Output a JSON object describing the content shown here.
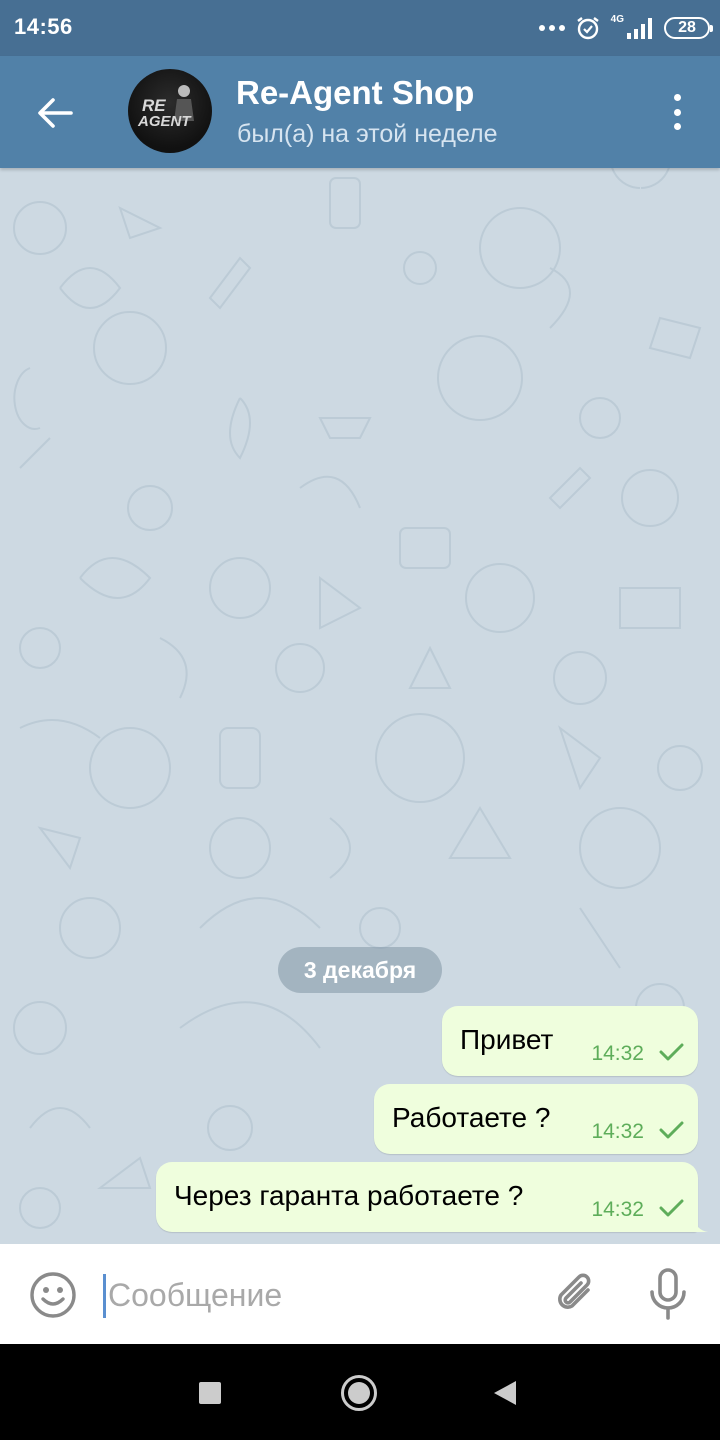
{
  "status_bar": {
    "time": "14:56",
    "network": "4G",
    "battery": "28"
  },
  "header": {
    "title": "Re-Agent Shop",
    "last_seen": "был(а) на этой неделе",
    "avatar_text_line1": "RE",
    "avatar_text_line2": "AGENT",
    "back_icon": "arrow-left-icon",
    "menu_icon": "more-vertical-icon"
  },
  "chat": {
    "date_separator": "3 декабря",
    "messages": [
      {
        "text": "Привет",
        "time": "14:32",
        "status": "sent"
      },
      {
        "text": "Работаете ?",
        "time": "14:32",
        "status": "sent"
      },
      {
        "text": "Через гаранта работаете ?",
        "time": "14:32",
        "status": "sent"
      }
    ]
  },
  "input": {
    "placeholder": "Сообщение",
    "value": "",
    "emoji_icon": "emoji-icon",
    "attach_icon": "paperclip-icon",
    "mic_icon": "microphone-icon"
  },
  "colors": {
    "header_bg": "#5181a8",
    "statusbar_bg": "#476f93",
    "chat_bg": "#cdd9e2",
    "bubble_bg": "#effedd",
    "time_green": "#5ead5a"
  }
}
